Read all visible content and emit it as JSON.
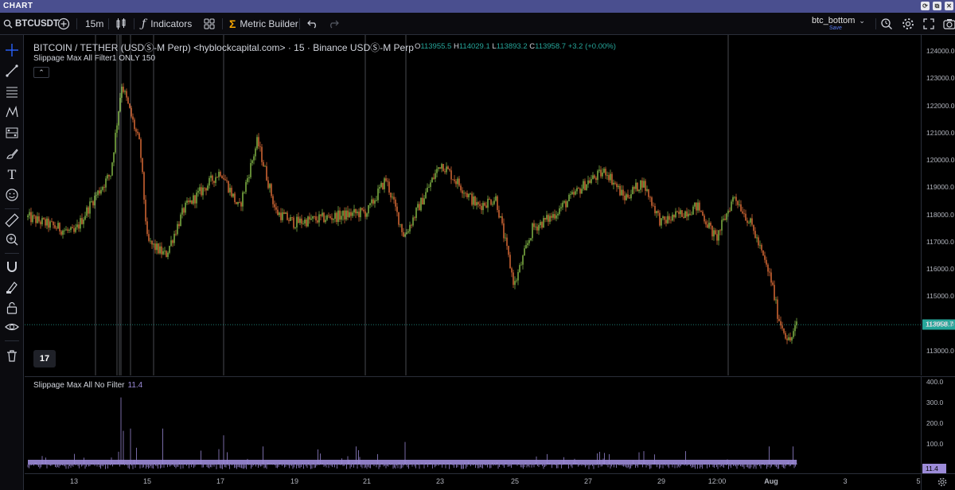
{
  "window": {
    "title": "CHART"
  },
  "toolbar": {
    "symbol": "BTCUSDT",
    "interval": "15m",
    "indicators_label": "Indicators",
    "metric_builder_label": "Metric Builder",
    "layout_name": "btc_bottom",
    "save_label": "Save"
  },
  "legend": {
    "title": "BITCOIN / TETHER (USDⓈ-M Perp) <hyblockcapital.com> · 15 · Binance USDⓈ-M Perp",
    "open_key": "O",
    "open": "113955.5",
    "high_key": "H",
    "high": "114029.1",
    "low_key": "L",
    "low": "113893.2",
    "close_key": "C",
    "close": "113958.7",
    "change": "+3.2 (+0.00%)",
    "indicator_main": "Slippage Max All Filter1 ONLY 150",
    "collapse_symbol": "⌃"
  },
  "sub_legend": {
    "title": "Slippage Max All No Filter",
    "value": "11.4"
  },
  "price_axis": {
    "ticks": [
      "124000.0",
      "123000.0",
      "122000.0",
      "121000.0",
      "120000.0",
      "119000.0",
      "118000.0",
      "117000.0",
      "116000.0",
      "115000.0",
      "114000.0",
      "113000.0"
    ],
    "current_price": "113958.7"
  },
  "sub_axis": {
    "ticks": [
      "400.0",
      "300.0",
      "200.0",
      "100.0"
    ],
    "current_value": "11.4"
  },
  "time_axis": {
    "labels": [
      "13",
      "15",
      "17",
      "19",
      "21",
      "23",
      "25",
      "27",
      "29",
      "12:00",
      "Aug",
      "3",
      "5"
    ]
  },
  "colors": {
    "up": "#8bc34a",
    "down": "#e8713a",
    "sub_series": "#9c8bd8",
    "price_tag": "#26a69a",
    "title_bar": "#4a4f8f"
  },
  "icons": {
    "left_tools": [
      "crosshair-icon",
      "trendline-icon",
      "fib-icon",
      "pattern-icon",
      "prediction-icon",
      "brush-icon",
      "text-icon",
      "emoji-icon",
      "ruler-icon",
      "zoom-in-icon",
      "magnet-icon",
      "lock-draw-icon",
      "lock-icon",
      "eye-icon",
      "trash-icon"
    ]
  },
  "chart_data": {
    "type": "candlestick",
    "x": [
      "13",
      "15",
      "17",
      "19",
      "21",
      "23",
      "25",
      "27",
      "29",
      "12:00",
      "Aug",
      "3",
      "5"
    ],
    "ylim": [
      112500,
      124300
    ],
    "price_path_approx": [
      [
        "Jul 12",
        117900
      ],
      [
        "Jul 13",
        117300
      ],
      [
        "Jul 13.5",
        118500
      ],
      [
        "Jul 14",
        119500
      ],
      [
        "Jul 14.3",
        122800
      ],
      [
        "Jul 14.8",
        120500
      ],
      [
        "Jul 15",
        117000
      ],
      [
        "Jul 15.5",
        116500
      ],
      [
        "Jul 16",
        118200
      ],
      [
        "Jul 17",
        119600
      ],
      [
        "Jul 17.5",
        118200
      ],
      [
        "Jul 18",
        120700
      ],
      [
        "Jul 18.5",
        118100
      ],
      [
        "Jul 19",
        117700
      ],
      [
        "Jul 20",
        117900
      ],
      [
        "Jul 21",
        118100
      ],
      [
        "Jul 21.5",
        119300
      ],
      [
        "Jul 22",
        117200
      ],
      [
        "Jul 23",
        119900
      ],
      [
        "Jul 24",
        118300
      ],
      [
        "Jul 24.5",
        118600
      ],
      [
        "Jul 25",
        115400
      ],
      [
        "Jul 25.5",
        117500
      ],
      [
        "Jul 26",
        117900
      ],
      [
        "Jul 27",
        119200
      ],
      [
        "Jul 27.5",
        119600
      ],
      [
        "Jul 28",
        118600
      ],
      [
        "Jul 28.5",
        119200
      ],
      [
        "Jul 29",
        117700
      ],
      [
        "Jul 30",
        118300
      ],
      [
        "Jul 30.5",
        117100
      ],
      [
        "Jul 31",
        118700
      ],
      [
        "Jul 31.5",
        117500
      ],
      [
        "Aug 1",
        115600
      ],
      [
        "Aug 1.2",
        114200
      ],
      [
        "Aug 1.5",
        113300
      ],
      [
        "Aug 1.7",
        113958.7
      ]
    ],
    "indicator": {
      "name": "Slippage Max All No Filter",
      "ylim": [
        0,
        430
      ],
      "last_value": 11.4
    }
  }
}
